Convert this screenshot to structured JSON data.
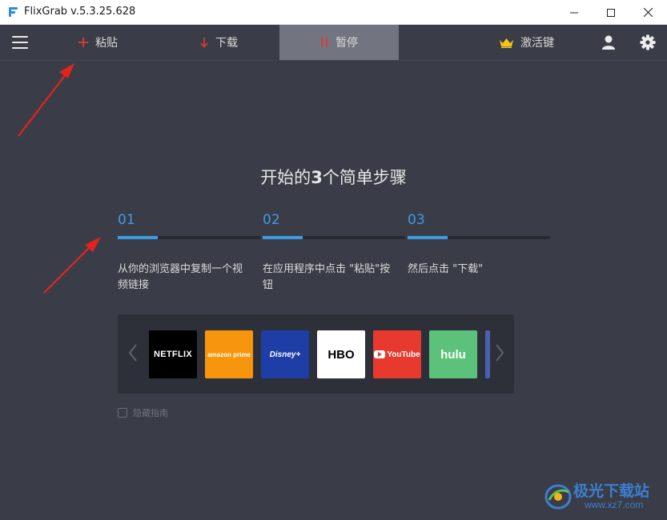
{
  "window": {
    "title": "FlixGrab  v.5.3.25.628"
  },
  "toolbar": {
    "paste_label": "粘贴",
    "download_label": "下载",
    "pause_label": "暂停",
    "activate_label": "激活键"
  },
  "guide": {
    "heading_prefix": "开始的",
    "heading_number": "3",
    "heading_suffix": "个简单步骤",
    "steps": [
      {
        "number": "01",
        "text": "从你的浏览器中复制一个视频链接",
        "progress": 0.28
      },
      {
        "number": "02",
        "text": "在应用程序中点击 \"粘贴\"按钮",
        "progress": 0.28
      },
      {
        "number": "03",
        "text": "然后点击 \"下载\"",
        "progress": 0.28
      }
    ],
    "hide_guide_label": "隐藏指南",
    "hide_guide_checked": false
  },
  "services": [
    {
      "name": "NETFLIX",
      "color": "#000000"
    },
    {
      "name": "amazon prime",
      "color": "#f7960d"
    },
    {
      "name": "Disney+",
      "color": "#1e3da6"
    },
    {
      "name": "HBO",
      "color": "#ffffff"
    },
    {
      "name": "YouTube",
      "color": "#e8392f"
    },
    {
      "name": "hulu",
      "color": "#5cc27b"
    }
  ],
  "icons": {
    "paste": "plus-icon",
    "download": "down-arrow-icon",
    "pause": "pause-icon",
    "activate": "crown-icon",
    "user": "user-icon",
    "settings": "gear-icon"
  },
  "colors": {
    "accent": "#3d9be4",
    "toolbar_icon_red": "#e03c31",
    "crown": "#f5c518",
    "background": "#3a3d47"
  },
  "watermark": {
    "text": "极光下载站",
    "url": "www.xz7.com"
  }
}
